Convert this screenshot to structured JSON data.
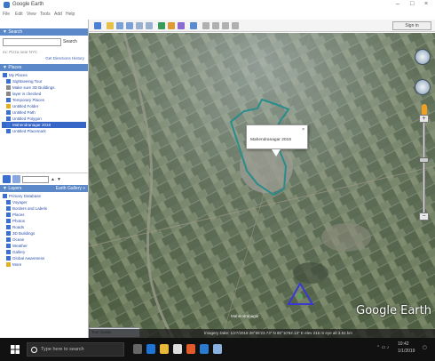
{
  "window": {
    "title": "Google Earth",
    "min": "–",
    "max": "□",
    "close": "×"
  },
  "menu": [
    "File",
    "Edit",
    "View",
    "Tools",
    "Add",
    "Help"
  ],
  "toolbar": {
    "tour_label": "Sign in"
  },
  "sidebar": {
    "search": {
      "header": "▼ Search",
      "button": "Search",
      "hint": "ex: Pizza near NYC",
      "links": "Get Directions  History"
    },
    "places": {
      "header": "▼ Places",
      "items": [
        {
          "label": "My Places",
          "color": "#3b6fd0",
          "selected": false
        },
        {
          "label": "Sightseeing Tour",
          "color": "#3b6fd0",
          "selected": false
        },
        {
          "label": "Make sure 3D Buildings",
          "color": "#888888",
          "selected": false
        },
        {
          "label": "layer is checked",
          "color": "#888888",
          "selected": false
        },
        {
          "label": "Temporary Places",
          "color": "#3b6fd0",
          "selected": false
        },
        {
          "label": "Untitled Folder",
          "color": "#e0b020",
          "selected": false
        },
        {
          "label": "Untitled Path",
          "color": "#3b6fd0",
          "selected": false
        },
        {
          "label": "Untitled Polygon",
          "color": "#3b6fd0",
          "selected": false
        },
        {
          "label": "Mahendranagar 2018",
          "color": "#3b6fd0",
          "selected": true
        },
        {
          "label": "Untitled Placemark",
          "color": "#3b6fd0",
          "selected": false
        }
      ]
    },
    "layers": {
      "header": "▼ Layers",
      "earth_gallery": "Earth Gallery »",
      "items": [
        {
          "label": "Primary Database",
          "color": "#3b6fd0"
        },
        {
          "label": "Voyager",
          "color": "#3b6fd0"
        },
        {
          "label": "Borders and Labels",
          "color": "#3b6fd0"
        },
        {
          "label": "Places",
          "color": "#3b6fd0"
        },
        {
          "label": "Photos",
          "color": "#3b6fd0"
        },
        {
          "label": "Roads",
          "color": "#3b6fd0"
        },
        {
          "label": "3D Buildings",
          "color": "#3b6fd0"
        },
        {
          "label": "Ocean",
          "color": "#3b6fd0"
        },
        {
          "label": "Weather",
          "color": "#3b6fd0"
        },
        {
          "label": "Gallery",
          "color": "#3b6fd0"
        },
        {
          "label": "Global Awareness",
          "color": "#3b6fd0"
        },
        {
          "label": "More",
          "color": "#e0b020"
        }
      ]
    }
  },
  "map": {
    "popup_text": "Mahendranagar 2018",
    "popup_close": "×",
    "logo": "Google Earth",
    "label": "Mahendranagar",
    "minimap_label": "Tour Guide",
    "status": "Imagery Date: 1/27/2018    28°55'23.73\" N  80°10'52.13\" E  elev 215 m   eye alt 3.51 km"
  },
  "taskbar": {
    "search_placeholder": "Type here to search",
    "time": "10:42",
    "date": "1/1/2019"
  },
  "colors": {
    "selection": "#3566c8",
    "polygon": "#2a8c8c",
    "polygon_blue": "#3a3ad0"
  }
}
